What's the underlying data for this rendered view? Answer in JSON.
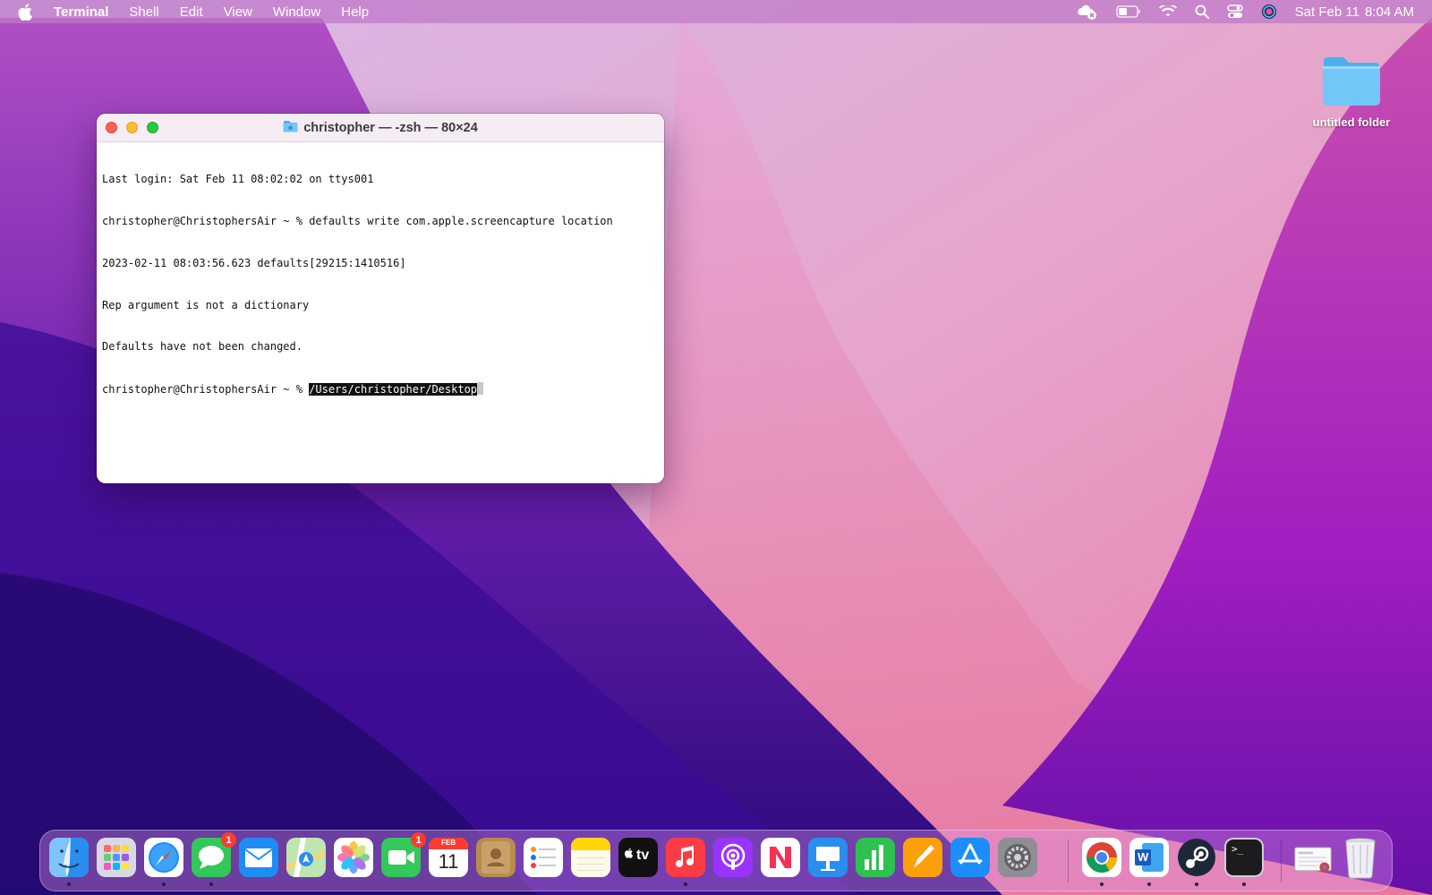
{
  "menubar": {
    "apple_icon": "apple-logo-icon",
    "app_name": "Terminal",
    "menus": [
      "Shell",
      "Edit",
      "View",
      "Window",
      "Help"
    ],
    "status_icons": [
      "cloud-disconnected-icon",
      "battery-icon",
      "wifi-icon",
      "spotlight-search-icon",
      "control-center-icon",
      "siri-icon"
    ],
    "date": "Sat Feb 11",
    "time": "8:04 AM"
  },
  "desktop": {
    "folder_label": "untitled folder"
  },
  "terminal": {
    "title": "christopher — -zsh — 80×24",
    "lines": [
      "Last login: Sat Feb 11 08:02:02 on ttys001",
      "christopher@ChristophersAir ~ % defaults write com.apple.screencapture location",
      "2023-02-11 08:03:56.623 defaults[29215:1410516]",
      "Rep argument is not a dictionary",
      "Defaults have not been changed."
    ],
    "prompt": "christopher@ChristophersAir ~ % ",
    "selected_text": "/Users/christopher/Desktop"
  },
  "dock": {
    "items": [
      {
        "name": "finder",
        "icon": "finder-icon"
      },
      {
        "name": "launchpad",
        "icon": "launchpad-icon"
      },
      {
        "name": "safari",
        "icon": "safari-icon"
      },
      {
        "name": "messages",
        "icon": "messages-icon",
        "badge": "1"
      },
      {
        "name": "mail",
        "icon": "mail-icon"
      },
      {
        "name": "maps",
        "icon": "maps-icon"
      },
      {
        "name": "photos",
        "icon": "photos-icon"
      },
      {
        "name": "facetime",
        "icon": "facetime-icon",
        "badge": "1"
      },
      {
        "name": "calendar",
        "icon": "calendar-icon",
        "month": "FEB",
        "day": "11"
      },
      {
        "name": "contacts",
        "icon": "contacts-icon"
      },
      {
        "name": "reminders",
        "icon": "reminders-icon"
      },
      {
        "name": "notes",
        "icon": "notes-icon"
      },
      {
        "name": "tv",
        "icon": "apple-tv-icon",
        "label": "tv"
      },
      {
        "name": "music",
        "icon": "music-icon"
      },
      {
        "name": "podcasts",
        "icon": "podcasts-icon"
      },
      {
        "name": "news",
        "icon": "news-icon"
      },
      {
        "name": "keynote",
        "icon": "keynote-icon"
      },
      {
        "name": "numbers",
        "icon": "numbers-icon"
      },
      {
        "name": "pages",
        "icon": "pages-icon"
      },
      {
        "name": "app-store",
        "icon": "app-store-icon"
      },
      {
        "name": "system-preferences",
        "icon": "system-preferences-icon"
      },
      {
        "name": "chrome",
        "icon": "chrome-icon"
      },
      {
        "name": "word",
        "icon": "word-icon",
        "label": "W"
      },
      {
        "name": "steam",
        "icon": "steam-icon"
      },
      {
        "name": "terminal",
        "icon": "terminal-icon",
        "label": ">_"
      },
      {
        "name": "downloads-stack",
        "icon": "downloads-stack-icon"
      },
      {
        "name": "trash",
        "icon": "trash-icon"
      }
    ]
  }
}
